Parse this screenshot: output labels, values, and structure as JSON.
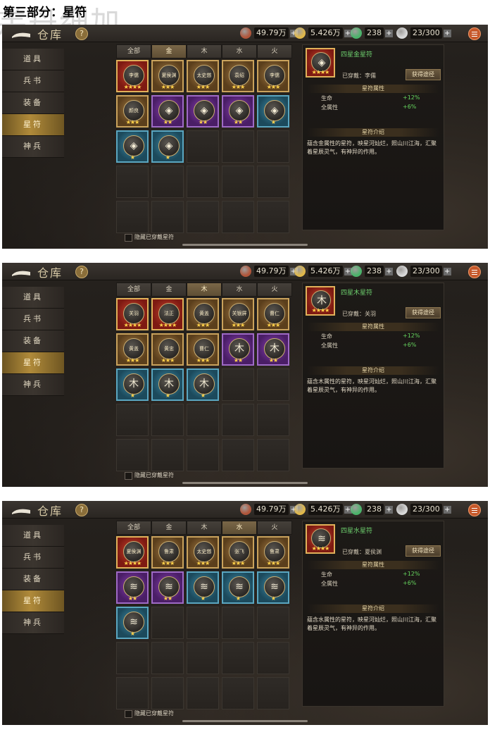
{
  "page": {
    "heading": "第三部分：星符",
    "watermark": "羔丹细加"
  },
  "shots": [
    {
      "top_bar": {
        "title": "仓库",
        "help_icon": "question-icon",
        "resources": [
          {
            "icon": "jade-seal-icon",
            "value": "49.79万"
          },
          {
            "icon": "gold-coin-icon",
            "value": "5.426万"
          },
          {
            "icon": "green-jade-icon",
            "value": "238"
          },
          {
            "icon": "silver-cloud-icon",
            "value": "23/300"
          }
        ],
        "plus": "+"
      },
      "sidebar": {
        "items": [
          {
            "label": "道具",
            "active": false
          },
          {
            "label": "兵书",
            "active": false
          },
          {
            "label": "装备",
            "active": false
          },
          {
            "label": "星符",
            "active": true
          },
          {
            "label": "神兵",
            "active": false
          }
        ]
      },
      "tabs": [
        {
          "label": "全部",
          "active": false
        },
        {
          "label": "金",
          "active": true
        },
        {
          "label": "木",
          "active": false
        },
        {
          "label": "水",
          "active": false
        },
        {
          "label": "火",
          "active": false
        }
      ],
      "grid": [
        {
          "rarity": 4,
          "label": "李儒",
          "stars": "★★★★"
        },
        {
          "rarity": 3,
          "label": "夏侯渊",
          "stars": "★★★"
        },
        {
          "rarity": 3,
          "label": "太史慈",
          "stars": "★★★"
        },
        {
          "rarity": 3,
          "label": "袁绍",
          "stars": "★★★"
        },
        {
          "rarity": 3,
          "label": "李儒",
          "stars": "★★★"
        },
        {
          "rarity": 3,
          "label": "颜良",
          "stars": "★★★"
        },
        {
          "rarity": 2,
          "symbol": "◈",
          "stars": "★★"
        },
        {
          "rarity": 2,
          "symbol": "◈",
          "stars": "★★"
        },
        {
          "rarity": 2,
          "symbol": "◈",
          "stars": "★★"
        },
        {
          "rarity": 1,
          "symbol": "◈",
          "stars": "★"
        },
        {
          "rarity": 1,
          "symbol": "◈",
          "stars": "★"
        },
        {
          "rarity": 1,
          "symbol": "◈",
          "stars": "★"
        }
      ],
      "detail": {
        "symbol": "◈",
        "stars": "★★★★",
        "name": "四星金星符",
        "equipped": "已穿戴：李儒",
        "button": "获得途径",
        "attr_title": "星符属性",
        "attrs": [
          {
            "name": "生命",
            "value": "+12%"
          },
          {
            "name": "全属性",
            "value": "+6%"
          }
        ],
        "desc_title": "星符介绍",
        "desc": "蕴含金属性的星符，映星河灿烂，照山川江海，汇聚着星辰灵气，有神异的作用。"
      },
      "hide_label": "隐藏已穿戴星符"
    },
    {
      "top_bar": {
        "title": "仓库",
        "help_icon": "question-icon",
        "resources": [
          {
            "icon": "jade-seal-icon",
            "value": "49.79万"
          },
          {
            "icon": "gold-coin-icon",
            "value": "5.426万"
          },
          {
            "icon": "green-jade-icon",
            "value": "238"
          },
          {
            "icon": "silver-cloud-icon",
            "value": "23/300"
          }
        ],
        "plus": "+"
      },
      "sidebar": {
        "items": [
          {
            "label": "道具",
            "active": false
          },
          {
            "label": "兵书",
            "active": false
          },
          {
            "label": "装备",
            "active": false
          },
          {
            "label": "星符",
            "active": true
          },
          {
            "label": "神兵",
            "active": false
          }
        ]
      },
      "tabs": [
        {
          "label": "全部",
          "active": false
        },
        {
          "label": "金",
          "active": false
        },
        {
          "label": "木",
          "active": true
        },
        {
          "label": "水",
          "active": false
        },
        {
          "label": "火",
          "active": false
        }
      ],
      "grid": [
        {
          "rarity": 4,
          "label": "关羽",
          "stars": "★★★★"
        },
        {
          "rarity": 4,
          "label": "法正",
          "stars": "★★★★"
        },
        {
          "rarity": 3,
          "label": "黄盖",
          "stars": "★★★"
        },
        {
          "rarity": 3,
          "label": "关银屏",
          "stars": "★★★"
        },
        {
          "rarity": 3,
          "label": "曹仁",
          "stars": "★★★"
        },
        {
          "rarity": 3,
          "label": "黄盖",
          "stars": "★★★"
        },
        {
          "rarity": 3,
          "label": "黄忠",
          "stars": "★★★"
        },
        {
          "rarity": 3,
          "label": "曹仁",
          "stars": "★★★"
        },
        {
          "rarity": 2,
          "symbol": "⽊",
          "stars": "★★"
        },
        {
          "rarity": 2,
          "symbol": "⽊",
          "stars": "★★"
        },
        {
          "rarity": 1,
          "symbol": "⽊",
          "stars": "★"
        },
        {
          "rarity": 1,
          "symbol": "⽊",
          "stars": "★"
        },
        {
          "rarity": 1,
          "symbol": "⽊",
          "stars": "★"
        }
      ],
      "detail": {
        "symbol": "⽊",
        "stars": "★★★★",
        "name": "四星木星符",
        "equipped": "已穿戴：关羽",
        "button": "获得途径",
        "attr_title": "星符属性",
        "attrs": [
          {
            "name": "生命",
            "value": "+12%"
          },
          {
            "name": "全属性",
            "value": "+6%"
          }
        ],
        "desc_title": "星符介绍",
        "desc": "蕴含木属性的星符，映星河灿烂，照山川江海，汇聚着星辰灵气，有神异的作用。"
      },
      "hide_label": "隐藏已穿戴星符"
    },
    {
      "top_bar": {
        "title": "仓库",
        "help_icon": "question-icon",
        "resources": [
          {
            "icon": "jade-seal-icon",
            "value": "49.79万"
          },
          {
            "icon": "gold-coin-icon",
            "value": "5.426万"
          },
          {
            "icon": "green-jade-icon",
            "value": "238"
          },
          {
            "icon": "silver-cloud-icon",
            "value": "23/300"
          }
        ],
        "plus": "+"
      },
      "sidebar": {
        "items": [
          {
            "label": "道具",
            "active": false
          },
          {
            "label": "兵书",
            "active": false
          },
          {
            "label": "装备",
            "active": false
          },
          {
            "label": "星符",
            "active": true
          },
          {
            "label": "神兵",
            "active": false
          }
        ]
      },
      "tabs": [
        {
          "label": "全部",
          "active": false
        },
        {
          "label": "金",
          "active": false
        },
        {
          "label": "木",
          "active": false
        },
        {
          "label": "水",
          "active": true
        },
        {
          "label": "火",
          "active": false
        }
      ],
      "grid": [
        {
          "rarity": 4,
          "label": "夏侯渊",
          "stars": "★★★★"
        },
        {
          "rarity": 3,
          "label": "鲁肃",
          "stars": "★★★"
        },
        {
          "rarity": 3,
          "label": "太史慈",
          "stars": "★★★"
        },
        {
          "rarity": 3,
          "label": "张飞",
          "stars": "★★★"
        },
        {
          "rarity": 3,
          "label": "鲁肃",
          "stars": "★★★"
        },
        {
          "rarity": 2,
          "symbol": "≋",
          "stars": "★★"
        },
        {
          "rarity": 2,
          "symbol": "≋",
          "stars": "★★"
        },
        {
          "rarity": 1,
          "symbol": "≋",
          "stars": "★"
        },
        {
          "rarity": 1,
          "symbol": "≋",
          "stars": "★"
        },
        {
          "rarity": 1,
          "symbol": "≋",
          "stars": "★"
        },
        {
          "rarity": 1,
          "symbol": "≋",
          "stars": "★"
        }
      ],
      "detail": {
        "symbol": "≋",
        "stars": "★★★★",
        "name": "四星水星符",
        "equipped": "已穿戴：夏侯渊",
        "button": "获得途径",
        "attr_title": "星符属性",
        "attrs": [
          {
            "name": "生命",
            "value": "+12%"
          },
          {
            "name": "全属性",
            "value": "+6%"
          }
        ],
        "desc_title": "星符介绍",
        "desc": "蕴含水属性的星符，映星河灿烂，照山川江海，汇聚着星辰灵气，有神异的作用。"
      },
      "hide_label": "隐藏已穿戴星符"
    }
  ]
}
